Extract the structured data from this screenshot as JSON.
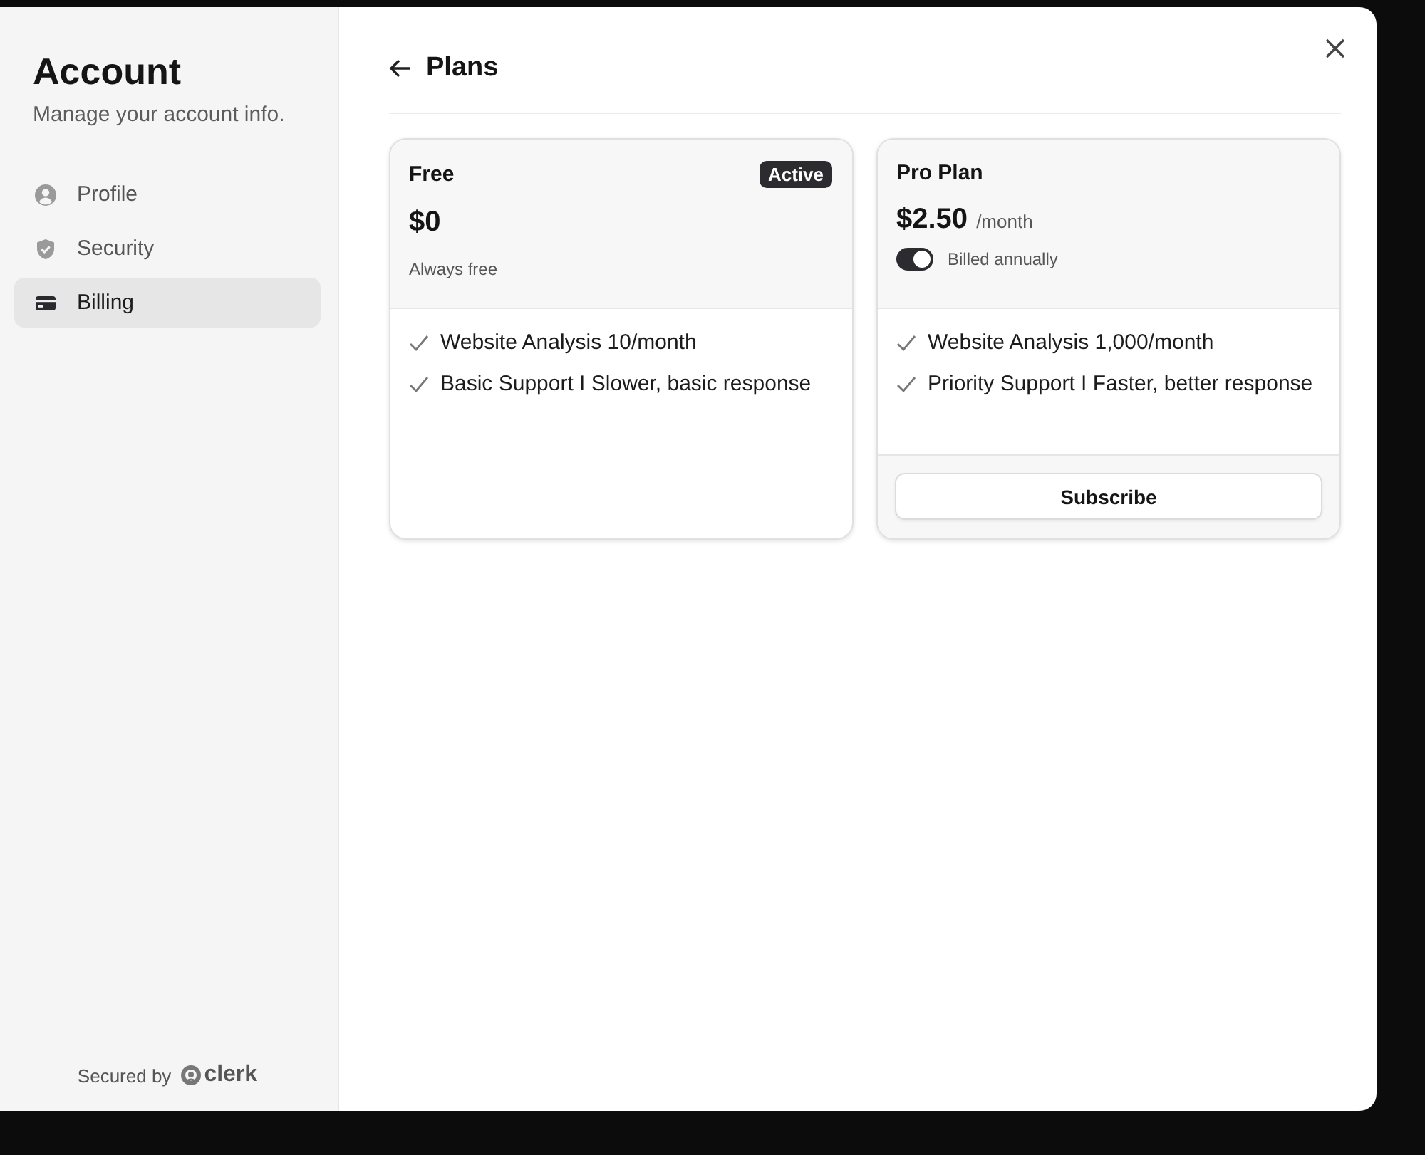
{
  "sidebar": {
    "title": "Account",
    "subtitle": "Manage your account info.",
    "items": [
      {
        "label": "Profile",
        "kind": "user",
        "selected": false
      },
      {
        "label": "Security",
        "kind": "shield",
        "selected": false
      },
      {
        "label": "Billing",
        "kind": "card",
        "selected": true
      }
    ],
    "footer": {
      "text": "Secured by",
      "brand": "clerk"
    }
  },
  "header": {
    "title": "Plans"
  },
  "plans": [
    {
      "name": "Free",
      "badge": "Active",
      "price": "$0",
      "note": "Always free",
      "features": [
        "Website Analysis 10/month",
        "Basic Support I Slower, basic response"
      ]
    },
    {
      "name": "Pro Plan",
      "price": "$2.50",
      "period": "/month",
      "billing_toggle": {
        "label": "Billed annually",
        "on": true
      },
      "features": [
        "Website Analysis 1,000/month",
        "Priority Support I Faster, better response"
      ],
      "button": "Subscribe"
    }
  ]
}
